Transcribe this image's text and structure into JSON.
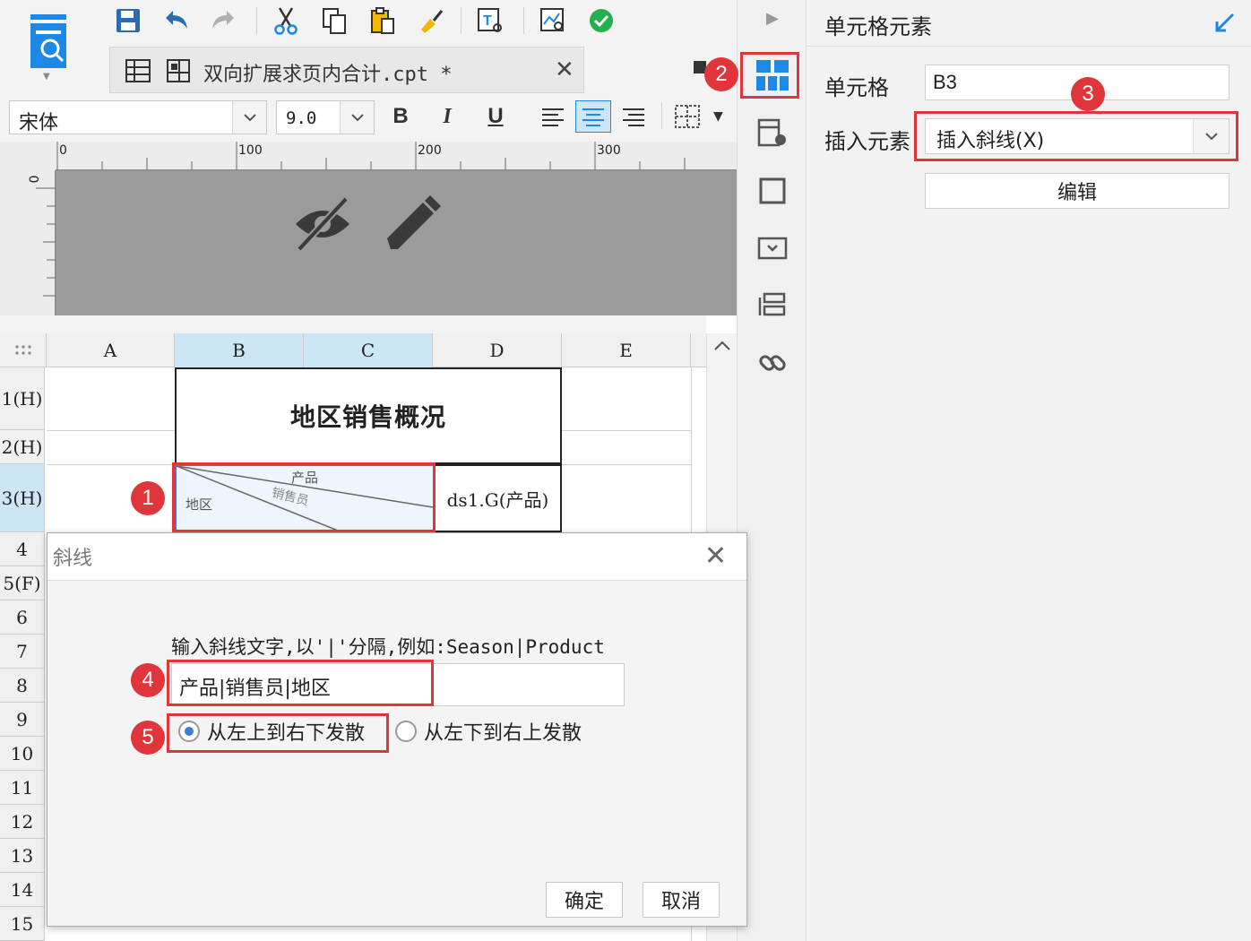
{
  "toolbar": {
    "tab_title": "双向扩展求页内合计.cpt *",
    "font_name": "宋体",
    "font_size": "9.0",
    "bold": "B",
    "italic": "I",
    "underline": "U"
  },
  "ruler": {
    "h_ticks": [
      "0",
      "100",
      "200",
      "300"
    ],
    "v_tick": "0"
  },
  "grid": {
    "columns": [
      "A",
      "B",
      "C",
      "D",
      "E"
    ],
    "rows": [
      "1(H)",
      "2(H)",
      "3(H)",
      "4",
      "5(F)",
      "6",
      "7",
      "8",
      "9",
      "10",
      "11",
      "12",
      "13",
      "14",
      "15"
    ],
    "title_cell": "地区销售概况",
    "diag_top": "产品",
    "diag_mid": "销售员",
    "diag_left": "地区",
    "d3_value": "ds1.G(产品)"
  },
  "panel": {
    "title": "单元格元素",
    "cell_label": "单元格",
    "cell_value": "B3",
    "insert_label": "插入元素",
    "insert_value": "插入斜线(X)",
    "edit_button": "编辑"
  },
  "dialog": {
    "title": "斜线",
    "instruction": "输入斜线文字,以'|'分隔,例如:Season|Product",
    "input_value": "产品|销售员|地区",
    "radio_1": "从左上到右下发散",
    "radio_2": "从左下到右上发散",
    "ok": "确定",
    "cancel": "取消"
  },
  "badges": [
    "1",
    "2",
    "3",
    "4",
    "5"
  ],
  "colors": {
    "accent_red": "#e0353b",
    "accent_blue": "#1e88e5",
    "selected_header": "#cde6f7"
  }
}
